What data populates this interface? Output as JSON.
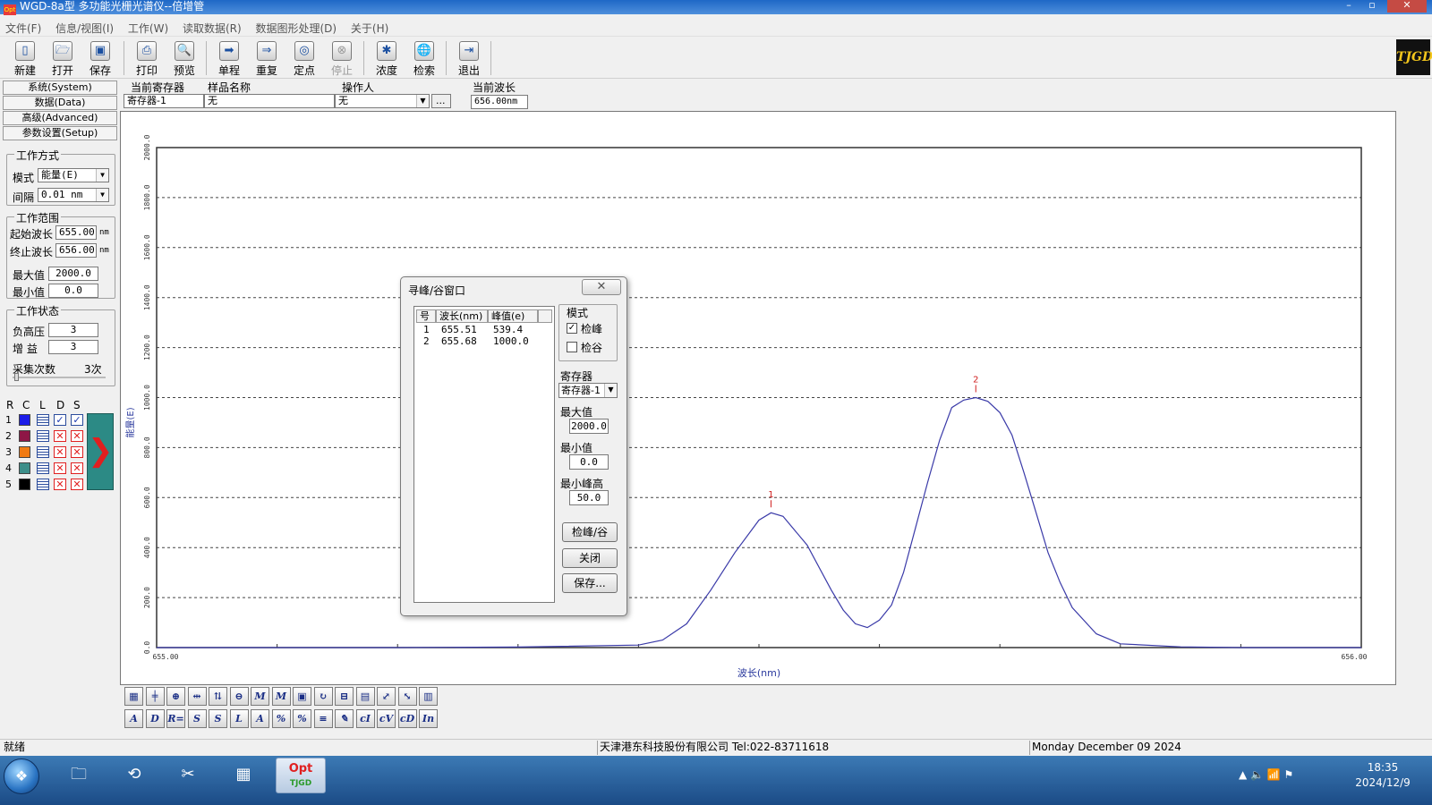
{
  "window": {
    "title": "WGD-8a型 多功能光栅光谱仪--倍增管",
    "logo_text": "Opt",
    "min": "–",
    "max": "▫",
    "close": "✕"
  },
  "menu": [
    "文件(F)",
    "信息/视图(I)",
    "工作(W)",
    "读取数据(R)",
    "数据图形处理(D)",
    "关于(H)"
  ],
  "toolbar": {
    "new": "新建",
    "open": "打开",
    "save": "保存",
    "print": "打印",
    "preview": "预览",
    "single": "单程",
    "repeat": "重复",
    "fixpoint": "定点",
    "stop": "停止",
    "concentration": "浓度",
    "search": "检索",
    "exit": "退出",
    "logo": "TJGD"
  },
  "left_tabs": [
    "系统(System)",
    "数据(Data)",
    "高级(Advanced)",
    "参数设置(Setup)"
  ],
  "work_mode": {
    "title": "工作方式",
    "mode_label": "模式",
    "mode_value": "能量(E)",
    "interval_label": "间隔",
    "interval_value": "0.01 nm"
  },
  "work_range": {
    "title": "工作范围",
    "start_label": "起始波长",
    "start_value": "655.00",
    "start_unit": "nm",
    "end_label": "终止波长",
    "end_value": "656.00",
    "end_unit": "nm",
    "max_label": "最大值",
    "max_value": "2000.0",
    "min_label": "最小值",
    "min_value": "0.0"
  },
  "work_state": {
    "title": "工作状态",
    "hv_label": "负高压",
    "hv_value": "3",
    "gain_label": "增  益",
    "gain_value": "3",
    "acq_label": "采集次数",
    "acq_value": "3次"
  },
  "channels": {
    "headers": [
      "R",
      "C",
      "L",
      "D",
      "S"
    ],
    "rows": [
      {
        "num": "1",
        "color": "#1c1ce8",
        "d": "✓",
        "s": "✓"
      },
      {
        "num": "2",
        "color": "#8e1646",
        "d": "✕",
        "s": "✕"
      },
      {
        "num": "3",
        "color": "#f07a12",
        "d": "✕",
        "s": "✕"
      },
      {
        "num": "4",
        "color": "#3d8f8a",
        "d": "✕",
        "s": "✕"
      },
      {
        "num": "5",
        "color": "#000000",
        "d": "✕",
        "s": "✕"
      }
    ],
    "arrow": "❯"
  },
  "header": {
    "register_label": "当前寄存器",
    "register_value": "寄存器-1",
    "sample_label": "样品名称",
    "sample_value": "无",
    "operator_label": "操作人",
    "operator_value": "无",
    "browse": "...",
    "wave_label": "当前波长",
    "wave_value": "656.00nm"
  },
  "chart_data": {
    "type": "line",
    "title": "",
    "xlabel": "波长(nm)",
    "ylabel": "能量(E)",
    "xlim": [
      655.0,
      656.0
    ],
    "ylim": [
      0,
      2000
    ],
    "x_ticks": [
      "655.00",
      "656.00"
    ],
    "y_ticks": [
      "0.0",
      "200.0",
      "400.0",
      "600.0",
      "800.0",
      "1000.0",
      "1200.0",
      "1400.0",
      "1600.0",
      "1800.0",
      "2000.0"
    ],
    "grid": true,
    "line_color": "#3a3aa8",
    "series": [
      {
        "x": [
          655.0,
          655.2,
          655.3,
          655.4,
          655.42,
          655.44,
          655.46,
          655.48,
          655.5,
          655.51,
          655.52,
          655.54,
          655.56,
          655.57,
          655.58,
          655.59,
          655.6,
          655.61,
          655.62,
          655.63,
          655.64,
          655.65,
          655.66,
          655.67,
          655.68,
          655.69,
          655.7,
          655.71,
          655.72,
          655.73,
          655.74,
          655.75,
          655.76,
          655.78,
          655.8,
          655.85,
          655.9,
          656.0
        ],
        "y": [
          0,
          0,
          2,
          10,
          30,
          95,
          230,
          380,
          510,
          539,
          525,
          410,
          230,
          150,
          95,
          80,
          110,
          170,
          300,
          480,
          660,
          830,
          960,
          990,
          1000,
          985,
          940,
          850,
          700,
          540,
          380,
          260,
          160,
          55,
          15,
          3,
          0,
          0
        ]
      }
    ],
    "peaks": [
      {
        "label": "1",
        "x": 655.51,
        "y": 539.4
      },
      {
        "label": "2",
        "x": 655.68,
        "y": 1000.0
      }
    ]
  },
  "bottom_tools": {
    "row1": [
      "▦",
      "╪",
      "⊕",
      "⇹",
      "⇅",
      "⊖",
      "M",
      "M",
      "▣",
      "↻",
      "⊟",
      "▤",
      "⤢",
      "⤡",
      "▥"
    ],
    "row2": [
      "A",
      "D",
      "R=",
      "S",
      "S",
      "L",
      "A",
      "%",
      "%",
      "≡",
      "✎",
      "cI",
      "cV",
      "cD",
      "In"
    ]
  },
  "status": {
    "left": "就绪",
    "company": "天津港东科技股份有限公司 Tel:022-83711618",
    "date": "Monday December 09 2024"
  },
  "taskbar": {
    "start": "❖",
    "items": [
      "🗀",
      "⟲",
      "✂",
      "▦"
    ],
    "opt_label": "Opt",
    "opt_sub": "TJGD",
    "tray_icons": "▲  🔈  📶  ⚑",
    "time": "18:35",
    "date": "2024/12/9"
  },
  "peak_dialog": {
    "title": "寻峰/谷窗口",
    "close": "✕",
    "col_num": "号",
    "col_wave": "波长(nm)",
    "col_value": "峰值(e)",
    "rows": [
      {
        "num": "1",
        "wave": "655.51",
        "value": "539.4"
      },
      {
        "num": "2",
        "wave": "655.68",
        "value": "1000.0"
      }
    ],
    "mode_title": "模式",
    "find_peak": "检峰",
    "find_peak_checked": "✓",
    "find_valley": "检谷",
    "register_label": "寄存器",
    "register_value": "寄存器-1",
    "max_label": "最大值",
    "max_value": "2000.0",
    "min_label": "最小值",
    "min_value": "0.0",
    "minpeak_label": "最小峰高",
    "minpeak_value": "50.0",
    "btn_find": "检峰/谷",
    "btn_close": "关闭",
    "btn_save": "保存..."
  }
}
